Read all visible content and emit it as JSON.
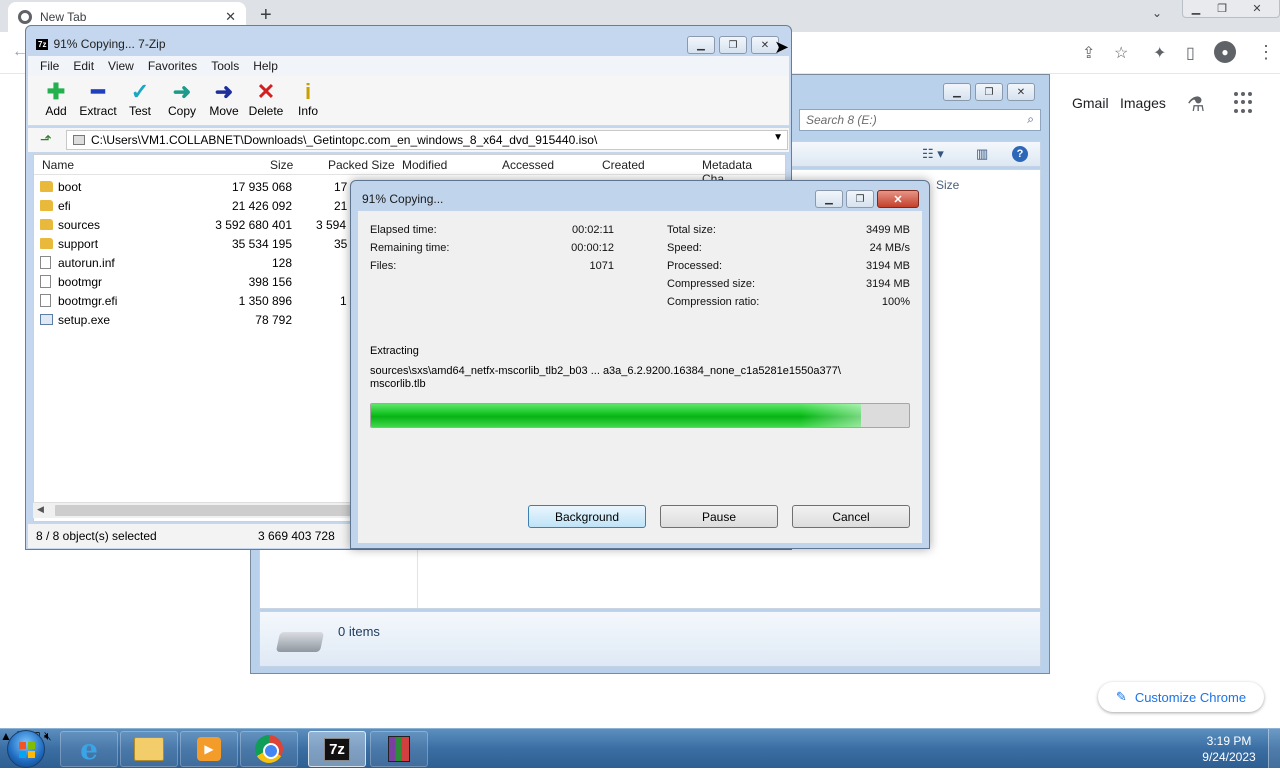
{
  "chrome": {
    "tab_title": "New Tab",
    "tab_close": "✕",
    "new_tab": "+",
    "links": [
      "Gmail",
      "Images"
    ],
    "customize_label": "Customize Chrome",
    "customize_icon": "pencil-icon"
  },
  "explorer": {
    "search_placeholder": "Search 8 (E:)",
    "column_size": "Size",
    "items_count": "0 items"
  },
  "sevenzip": {
    "title": "91% Copying... 7-Zip",
    "logo": "7z",
    "menu": [
      "File",
      "Edit",
      "View",
      "Favorites",
      "Tools",
      "Help"
    ],
    "toolbar": [
      {
        "label": "Add",
        "glyph": "✚",
        "color": "#22b14c"
      },
      {
        "label": "Extract",
        "glyph": "━",
        "color": "#1f3fbf"
      },
      {
        "label": "Test",
        "glyph": "✓",
        "color": "#1aa7c4"
      },
      {
        "label": "Copy",
        "glyph": "➜",
        "color": "#1d9a8a"
      },
      {
        "label": "Move",
        "glyph": "➜",
        "color": "#1c2f9a"
      },
      {
        "label": "Delete",
        "glyph": "✕",
        "color": "#d21f1f"
      },
      {
        "label": "Info",
        "glyph": "i",
        "color": "#c8a000"
      }
    ],
    "path": "C:\\Users\\VM1.COLLABNET\\Downloads\\_Getintopc.com_en_windows_8_x64_dvd_915440.iso\\",
    "columns": [
      "Name",
      "Size",
      "Packed Size",
      "Modified",
      "Accessed",
      "Created",
      "Metadata Cha..."
    ],
    "files": [
      {
        "name": "boot",
        "size": "17 935 068",
        "packed": "17",
        "type": "folder"
      },
      {
        "name": "efi",
        "size": "21 426 092",
        "packed": "21",
        "type": "folder"
      },
      {
        "name": "sources",
        "size": "3 592 680 401",
        "packed": "3 594",
        "type": "folder"
      },
      {
        "name": "support",
        "size": "35 534 195",
        "packed": "35",
        "type": "folder"
      },
      {
        "name": "autorun.inf",
        "size": "128",
        "packed": "",
        "type": "file"
      },
      {
        "name": "bootmgr",
        "size": "398 156",
        "packed": "",
        "type": "file"
      },
      {
        "name": "bootmgr.efi",
        "size": "1 350 896",
        "packed": "1",
        "type": "file"
      },
      {
        "name": "setup.exe",
        "size": "78 792",
        "packed": "",
        "type": "exe"
      }
    ],
    "status_selected": "8 / 8 object(s) selected",
    "status_size": "3 669 403 728"
  },
  "progress": {
    "title": "91% Copying...",
    "elapsed_label": "Elapsed time:",
    "elapsed_value": "00:02:11",
    "remaining_label": "Remaining time:",
    "remaining_value": "00:00:12",
    "files_label": "Files:",
    "files_value": "1071",
    "total_label": "Total size:",
    "total_value": "3499 MB",
    "speed_label": "Speed:",
    "speed_value": "24 MB/s",
    "processed_label": "Processed:",
    "processed_value": "3194 MB",
    "compressed_label": "Compressed size:",
    "compressed_value": "3194 MB",
    "ratio_label": "Compression ratio:",
    "ratio_value": "100%",
    "extracting_label": "Extracting",
    "extract_path_line1": "sources\\sxs\\amd64_netfx-mscorlib_tlb2_b03 ... a3a_6.2.9200.16384_none_c1a5281e1550a377\\",
    "extract_path_line2": "mscorlib.tlb",
    "progress_fraction": 0.91,
    "buttons": {
      "background": "Background",
      "pause": "Pause",
      "cancel": "Cancel"
    }
  },
  "taskbar": {
    "sevenzip_label": "7z",
    "clock_time": "3:19 PM",
    "clock_date": "9/24/2023"
  }
}
